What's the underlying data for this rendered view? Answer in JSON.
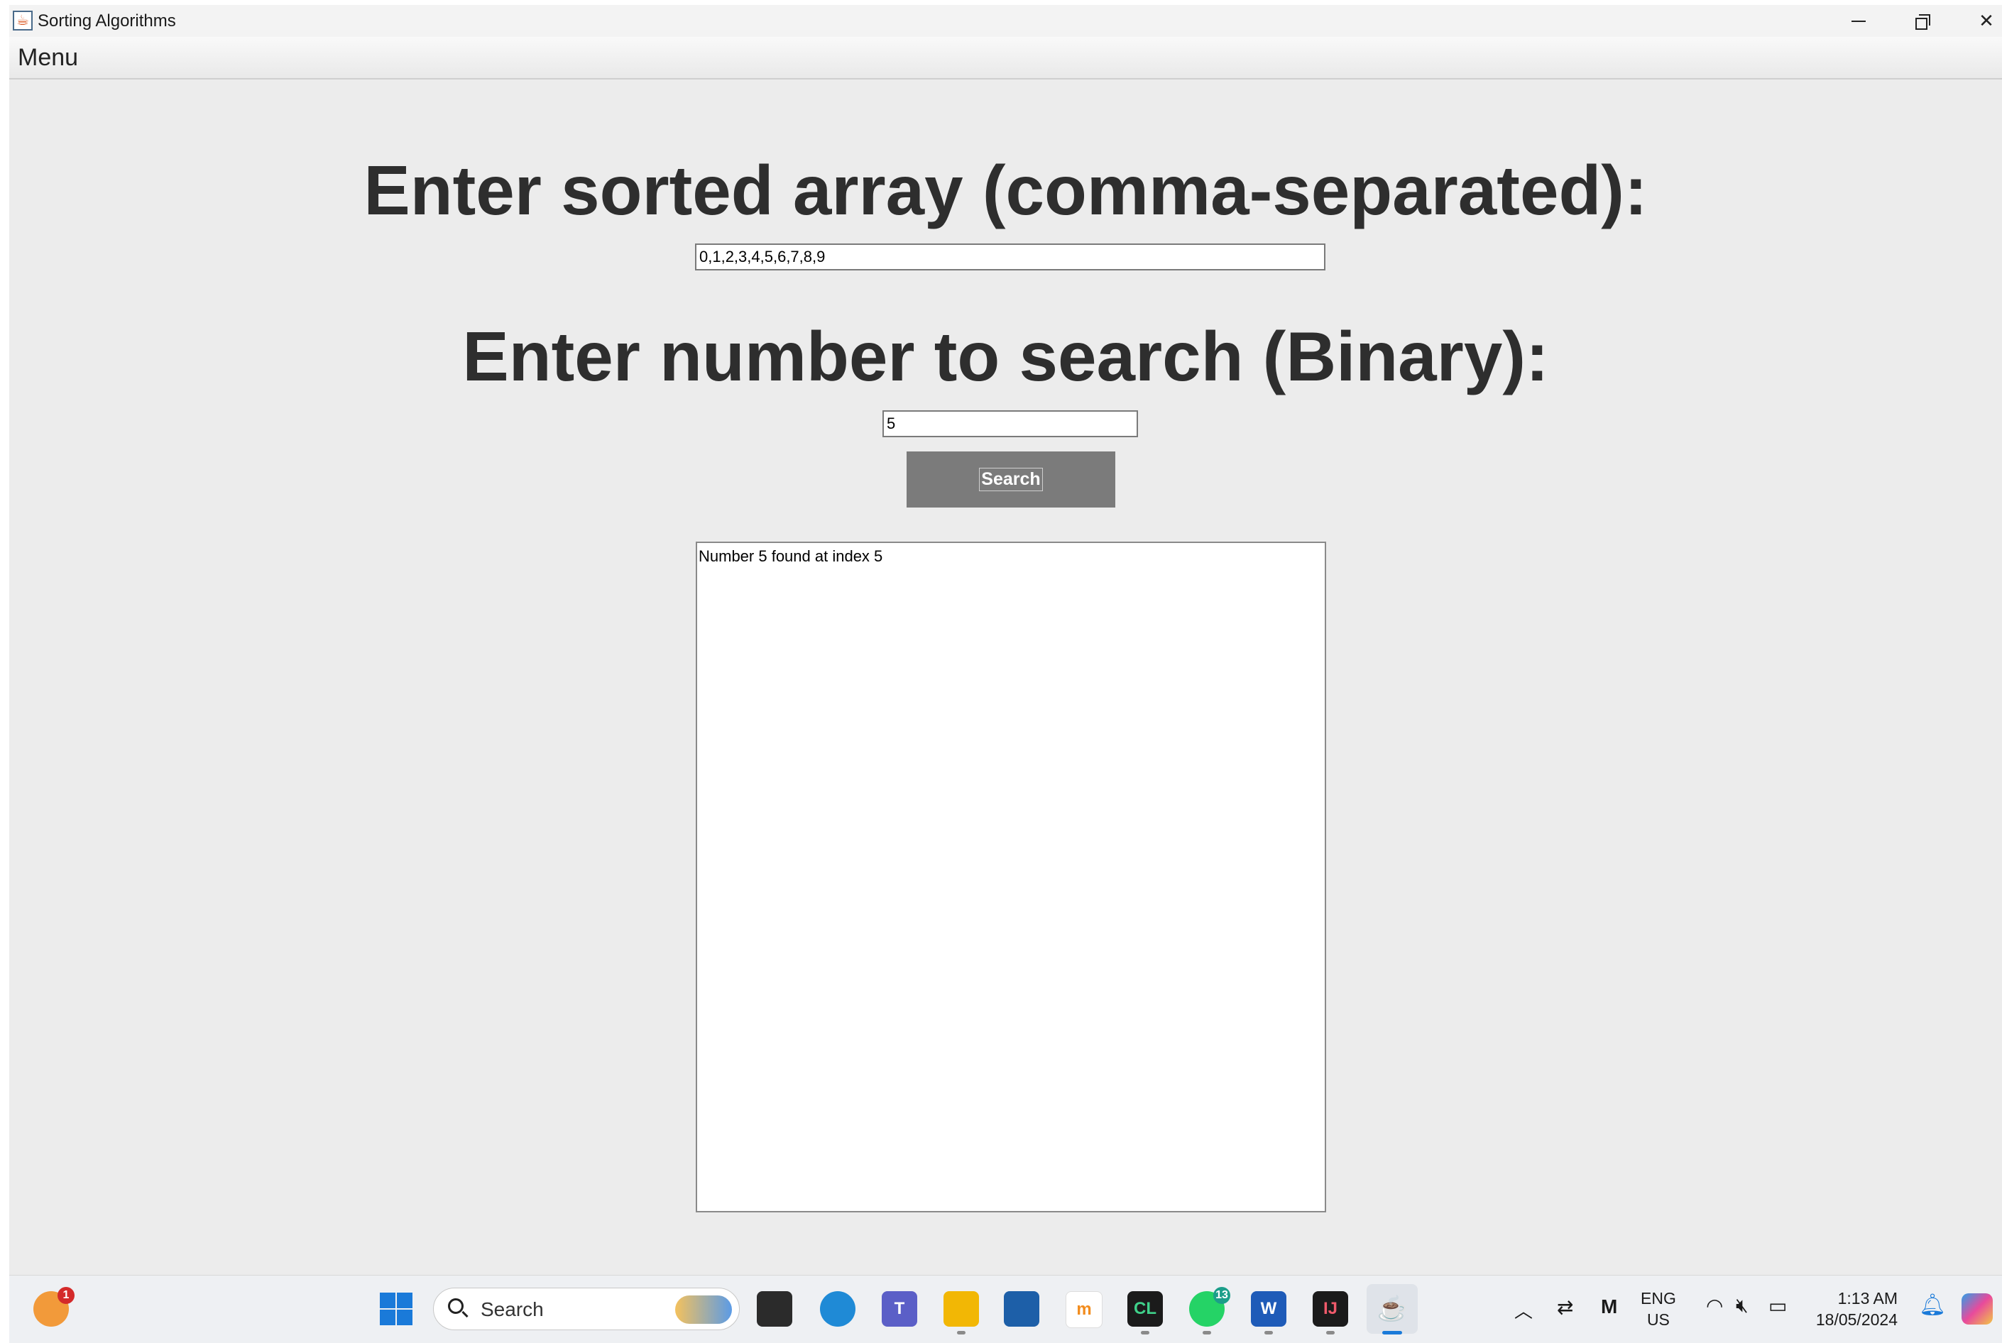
{
  "window": {
    "title": "Sorting Algorithms",
    "app_icon": "java-icon",
    "controls": {
      "minimize": "minimize-icon",
      "maximize": "restore-icon",
      "close": "✕"
    }
  },
  "menubar": {
    "menu_label": "Menu"
  },
  "form": {
    "array_label": "Enter sorted array (comma-separated):",
    "array_value": "0,1,2,3,4,5,6,7,8,9",
    "search_label": "Enter number to search (Binary):",
    "number_value": "5",
    "search_button_label": "Search"
  },
  "result": {
    "text": "Number 5 found at index 5"
  },
  "taskbar": {
    "weather_badge": "1",
    "search_placeholder": "Search",
    "clion_label": "CL",
    "whatsapp_badge": "13",
    "word_label": "W",
    "intellij_label": "IJ",
    "teams_label": "T",
    "moodle_label": "m",
    "tray": {
      "language": "ENG",
      "region": "US",
      "time": "1:13 AM",
      "date": "18/05/2024"
    }
  },
  "colors": {
    "window_background": "#ececec",
    "button_background": "#7b7b7b",
    "heading_text": "#2e2e2e",
    "taskbar_background": "#eef0f3"
  }
}
